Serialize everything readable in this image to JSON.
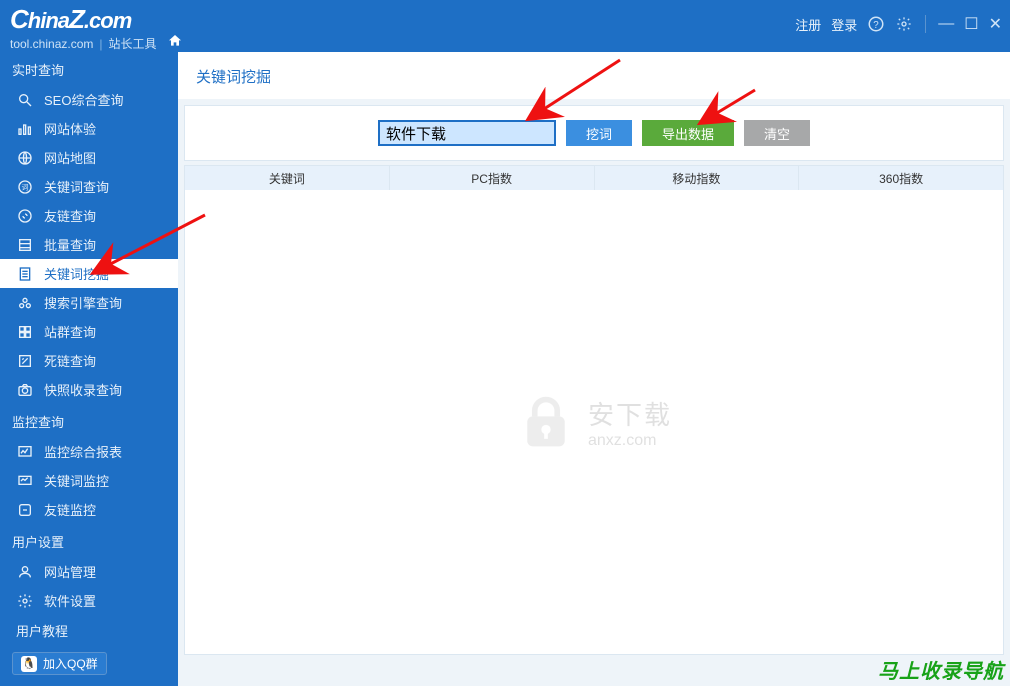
{
  "header": {
    "logo_text": "ChinaZ.com",
    "subdomain": "tool.chinaz.com",
    "sub_label": "站长工具",
    "register": "注册",
    "login": "登录"
  },
  "sidebar": {
    "sections": [
      {
        "title": "实时查询",
        "items": [
          {
            "label": "SEO综合查询",
            "icon": "seo-icon"
          },
          {
            "label": "网站体验",
            "icon": "chart-icon"
          },
          {
            "label": "网站地图",
            "icon": "globe-icon"
          },
          {
            "label": "关键词查询",
            "icon": "keyword-icon"
          },
          {
            "label": "友链查询",
            "icon": "link-icon"
          },
          {
            "label": "批量查询",
            "icon": "batch-icon"
          },
          {
            "label": "关键词挖掘",
            "icon": "doc-icon",
            "active": true
          },
          {
            "label": "搜索引擎查询",
            "icon": "search-engine-icon"
          },
          {
            "label": "站群查询",
            "icon": "sitegroup-icon"
          },
          {
            "label": "死链查询",
            "icon": "deadlink-icon"
          },
          {
            "label": "快照收录查询",
            "icon": "snapshot-icon"
          }
        ]
      },
      {
        "title": "监控查询",
        "items": [
          {
            "label": "监控综合报表",
            "icon": "monitor-icon"
          },
          {
            "label": "关键词监控",
            "icon": "keyword-monitor-icon"
          },
          {
            "label": "友链监控",
            "icon": "link-monitor-icon"
          }
        ]
      },
      {
        "title": "用户设置",
        "items": [
          {
            "label": "网站管理",
            "icon": "site-mgmt-icon"
          },
          {
            "label": "软件设置",
            "icon": "settings-icon"
          }
        ]
      }
    ],
    "tutorial": "用户教程",
    "qq_join": "加入QQ群"
  },
  "main": {
    "page_title": "关键词挖掘",
    "input_value": "软件下载",
    "btn_dig": "挖词",
    "btn_export": "导出数据",
    "btn_clear": "清空",
    "table_headers": [
      "关键词",
      "PC指数",
      "移动指数",
      "360指数"
    ]
  },
  "watermark": {
    "title": "安下载",
    "sub": "anxz.com"
  },
  "promo": "马上收录导航"
}
